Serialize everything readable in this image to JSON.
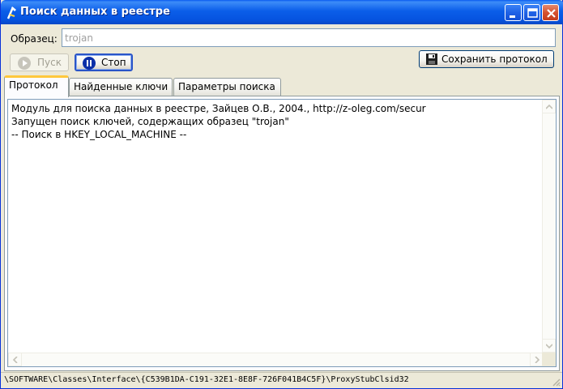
{
  "window": {
    "title": "Поиск данных в реестре",
    "accent_color": "#0a5bf0"
  },
  "search": {
    "label": "Образец:",
    "value": "trojan"
  },
  "toolbar": {
    "start_label": "Пуск",
    "stop_label": "Стоп",
    "save_label": "Сохранить протокол"
  },
  "tabs": [
    {
      "label": "Протокол",
      "active": true
    },
    {
      "label": "Найденные ключи",
      "active": false
    },
    {
      "label": "Параметры поиска",
      "active": false
    }
  ],
  "log": {
    "lines": [
      "Модуль для поиска данных в реестре, Зайцев О.В., 2004., http://z-oleg.com/secur",
      "Запущен поиск ключей, содержащих образец \"trojan\"",
      "-- Поиск в HKEY_LOCAL_MACHINE --"
    ]
  },
  "status": {
    "path": "\\SOFTWARE\\Classes\\Interface\\{C539B1DA-C191-32E1-8E8F-726F041B4C5F}\\ProxyStubClsid32"
  },
  "icons": {
    "app": "registry-tool-icon",
    "start": "play-icon",
    "stop": "pause-icon",
    "save": "floppy-disk-icon"
  }
}
